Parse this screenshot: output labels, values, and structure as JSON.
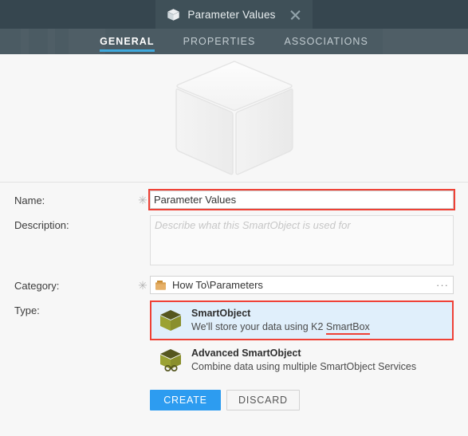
{
  "window": {
    "tab": {
      "icon": "cube-icon",
      "title": "Parameter Values",
      "close_icon": "close-icon"
    },
    "nav_tabs": [
      {
        "label": "GENERAL",
        "active": true
      },
      {
        "label": "PROPERTIES",
        "active": false
      },
      {
        "label": "ASSOCIATIONS",
        "active": false
      }
    ]
  },
  "hero": {
    "icon": "smartobject-cube-icon"
  },
  "form": {
    "name": {
      "label": "Name:",
      "required_marker": "✳",
      "value": "Parameter Values",
      "highlighted": true
    },
    "description": {
      "label": "Description:",
      "value": "",
      "placeholder": "Describe what this SmartObject is used for"
    },
    "category": {
      "label": "Category:",
      "required_marker": "✳",
      "folder_icon": "folder-icon",
      "value": "How To\\Parameters",
      "browse_label": "···"
    },
    "type": {
      "label": "Type:",
      "options": [
        {
          "icon": "smartobject-cube-icon",
          "title": "SmartObject",
          "subtitle_prefix": "We'll store your data using K2 ",
          "subtitle_highlight": "SmartBox",
          "selected": true
        },
        {
          "icon": "advanced-smartobject-icon",
          "title": "Advanced SmartObject",
          "subtitle_prefix": "Combine data using multiple SmartObject Services",
          "subtitle_highlight": "",
          "selected": false
        }
      ]
    }
  },
  "actions": {
    "create_label": "CREATE",
    "discard_label": "DISCARD"
  },
  "colors": {
    "topbar": "#36464f",
    "tabbar": "#4b5b63",
    "accent_blue": "#3fa9dd",
    "primary_button": "#2d9cf0",
    "highlight_red": "#ef4136",
    "selected_row": "#e0effb",
    "cube_olive": "#8f9435",
    "folder_tan": "#e3ab5e"
  }
}
